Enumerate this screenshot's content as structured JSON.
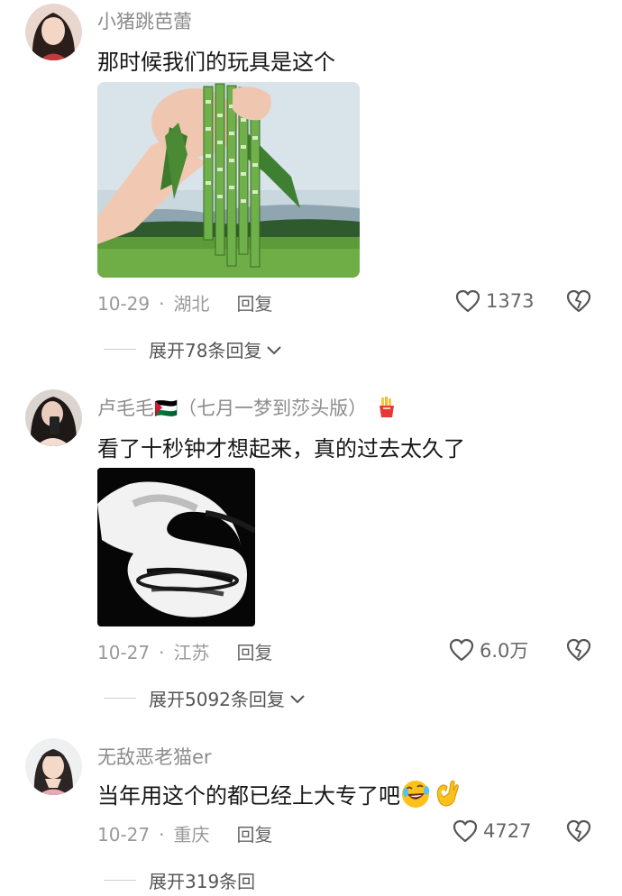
{
  "comments": [
    {
      "username": "小猪跳芭蕾",
      "text": "那时候我们的玩具是这个",
      "date": "10-29",
      "dot": "·",
      "location": "湖北",
      "reply": "回复",
      "likes": "1373",
      "expand": "展开78条回复"
    },
    {
      "username": "卢毛毛🇵🇸（七月一梦到莎头版）",
      "username_badge": "fries-icon",
      "text": "看了十秒钟才想起来，真的过去太久了",
      "date": "10-27",
      "dot": "·",
      "location": "江苏",
      "reply": "回复",
      "likes": "6.0万",
      "expand": "展开5092条回复"
    },
    {
      "username": "无敌恶老猫er",
      "text": "当年用这个的都已经上大专了吧",
      "text_emojis": [
        "rolling-laughing-emoji",
        "ok-hand-emoji"
      ],
      "date": "10-27",
      "dot": "·",
      "location": "重庆",
      "reply": "回复",
      "likes": "4727",
      "expand": "展开319条回"
    }
  ],
  "colors": {
    "username": "#8c8c8c",
    "text": "#161616",
    "meta": "#999999",
    "icon": "#555555"
  }
}
